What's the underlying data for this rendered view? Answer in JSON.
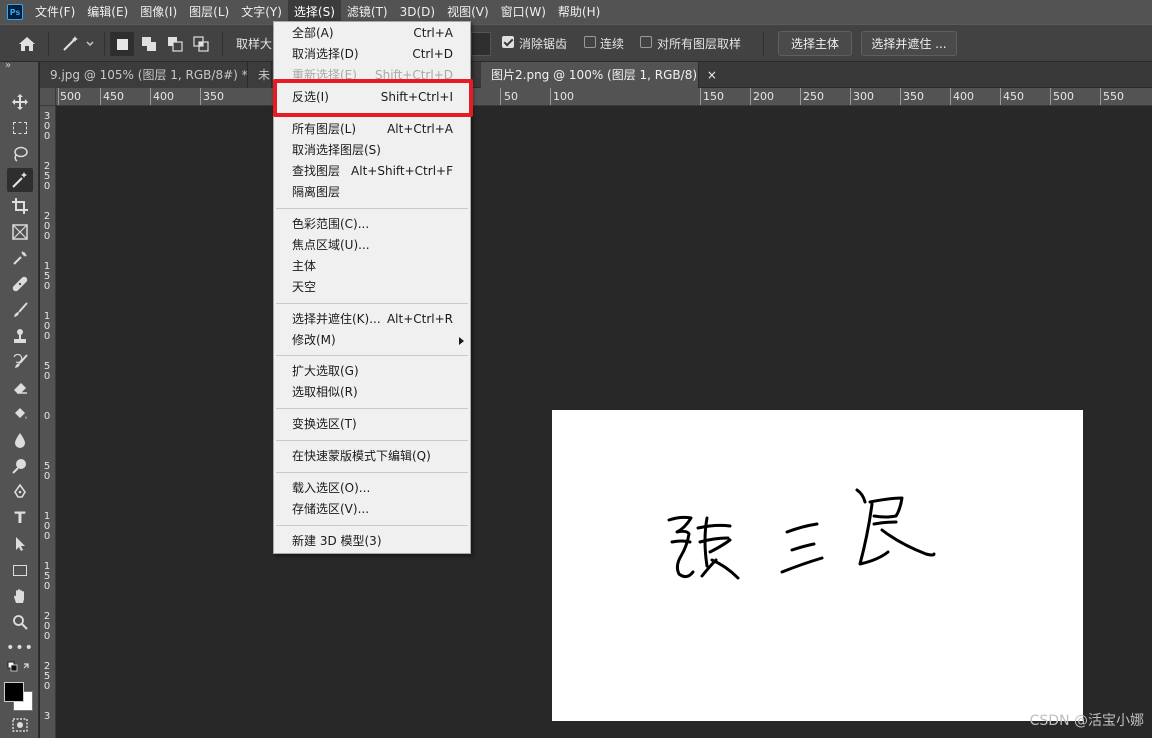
{
  "app": {
    "logo": "Ps"
  },
  "menubar": {
    "items": [
      "文件(F)",
      "编辑(E)",
      "图像(I)",
      "图层(L)",
      "文字(Y)",
      "选择(S)",
      "滤镜(T)",
      "3D(D)",
      "视图(V)",
      "窗口(W)",
      "帮助(H)"
    ],
    "active_index": 5
  },
  "options": {
    "sample_size_label": "取样大",
    "anti_alias": {
      "label": "消除锯齿",
      "checked": true
    },
    "contiguous": {
      "label": "连续",
      "checked": false
    },
    "sample_all_layers": {
      "label": "对所有图层取样",
      "checked": false
    },
    "select_subject": "选择主体",
    "select_and_mask": "选择并遮住 ..."
  },
  "toolbar": {
    "expand_glyph": "»"
  },
  "tabs": [
    {
      "label": "9.jpg @ 105% (图层 1, RGB/8#) *",
      "close": "×",
      "active": false
    },
    {
      "label": "未",
      "close": "",
      "active": false
    },
    {
      "label": "图片2.png @ 100% (图层 1, RGB/8)",
      "close": "×",
      "active": true
    }
  ],
  "ruler_h": [
    "500",
    "450",
    "400",
    "350",
    "50",
    "100",
    "150",
    "200",
    "250",
    "300",
    "350",
    "400",
    "450",
    "500",
    "550"
  ],
  "ruler_v": [
    "3\n0\n0",
    "2\n5\n0",
    "2\n0\n0",
    "1\n5\n0",
    "1\n0\n0",
    "5\n0",
    "0",
    "5\n0",
    "1\n0\n0",
    "1\n5\n0",
    "2\n0\n0",
    "2\n5\n0",
    "3"
  ],
  "menu": {
    "items": [
      {
        "label": "全部(A)",
        "shortcut": "Ctrl+A"
      },
      {
        "label": "取消选择(D)",
        "shortcut": "Ctrl+D"
      },
      {
        "label": "重新选择(E)",
        "shortcut": "Shift+Ctrl+D",
        "disabled": true
      },
      {
        "label": "反选(I)",
        "shortcut": "Shift+Ctrl+I"
      },
      {
        "label": "所有图层(L)",
        "shortcut": "Alt+Ctrl+A"
      },
      {
        "label": "取消选择图层(S)",
        "shortcut": ""
      },
      {
        "label": "查找图层",
        "shortcut": "Alt+Shift+Ctrl+F"
      },
      {
        "label": "隔离图层",
        "shortcut": ""
      },
      {
        "label": "色彩范围(C)...",
        "shortcut": ""
      },
      {
        "label": "焦点区域(U)...",
        "shortcut": ""
      },
      {
        "label": "主体",
        "shortcut": ""
      },
      {
        "label": "天空",
        "shortcut": ""
      },
      {
        "label": "选择并遮住(K)...",
        "shortcut": "Alt+Ctrl+R"
      },
      {
        "label": "修改(M)",
        "shortcut": ""
      },
      {
        "label": "扩大选取(G)",
        "shortcut": ""
      },
      {
        "label": "选取相似(R)",
        "shortcut": ""
      },
      {
        "label": "变换选区(T)",
        "shortcut": ""
      },
      {
        "label": "在快速蒙版模式下编辑(Q)",
        "shortcut": ""
      },
      {
        "label": "载入选区(O)...",
        "shortcut": ""
      },
      {
        "label": "存储选区(V)...",
        "shortcut": ""
      },
      {
        "label": "新建 3D 模型(3)",
        "shortcut": ""
      }
    ],
    "highlighted": "反选(I)"
  },
  "watermark": "CSDN @活宝小娜",
  "colors": {
    "highlight_border": "#e51c23",
    "menubar_bg": "#535353",
    "canvas_bg": "#282828"
  }
}
